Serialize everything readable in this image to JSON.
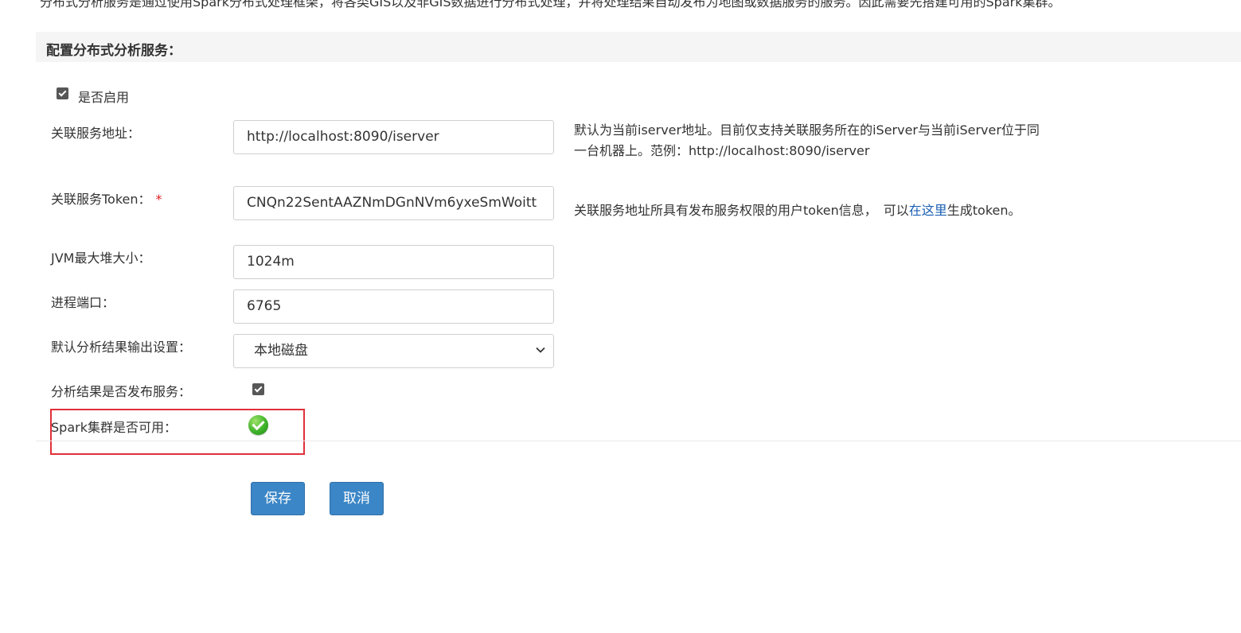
{
  "intro_text": "分布式分析服务是通过使用Spark分布式处理框架，将各类GIS以及非GIS数据进行分布式处理，并将处理结果自动发布为地图或数据服务的服务。因此需要先搭建可用的Spark集群。",
  "section_title": "配置分布式分析服务：",
  "enable": {
    "label": "是否启用",
    "checked": true
  },
  "service_address": {
    "label": "关联服务地址：",
    "value": "http://localhost:8090/iserver",
    "help_line1": "默认为当前iserver地址。目前仅支持关联服务所在的iServer与当前iServer位于同",
    "help_line2": "一台机器上。范例：http://localhost:8090/iserver"
  },
  "service_token": {
    "label": "关联服务Token：",
    "required_mark": "*",
    "value": "CNQn22SentAAZNmDGnNVm6yxeSmWoitt",
    "help_prefix": "关联服务地址所具有发布服务权限的用户token信息，　可以",
    "help_link": "在这里",
    "help_suffix": "生成token。"
  },
  "jvm_heap": {
    "label": "JVM最大堆大小：",
    "value": "1024m"
  },
  "process_port": {
    "label": "进程端口：",
    "value": "6765"
  },
  "output_setting": {
    "label": "默认分析结果输出设置：",
    "selected": "本地磁盘"
  },
  "publish_service": {
    "label": "分析结果是否发布服务：",
    "checked": true
  },
  "spark_cluster": {
    "label": "Spark集群是否可用：",
    "status_icon": "success-check-icon",
    "status_color": "#3eb32a"
  },
  "buttons": {
    "save": "保存",
    "cancel": "取消",
    "color": "#3b86c6"
  },
  "highlight_color": "#e0303a"
}
